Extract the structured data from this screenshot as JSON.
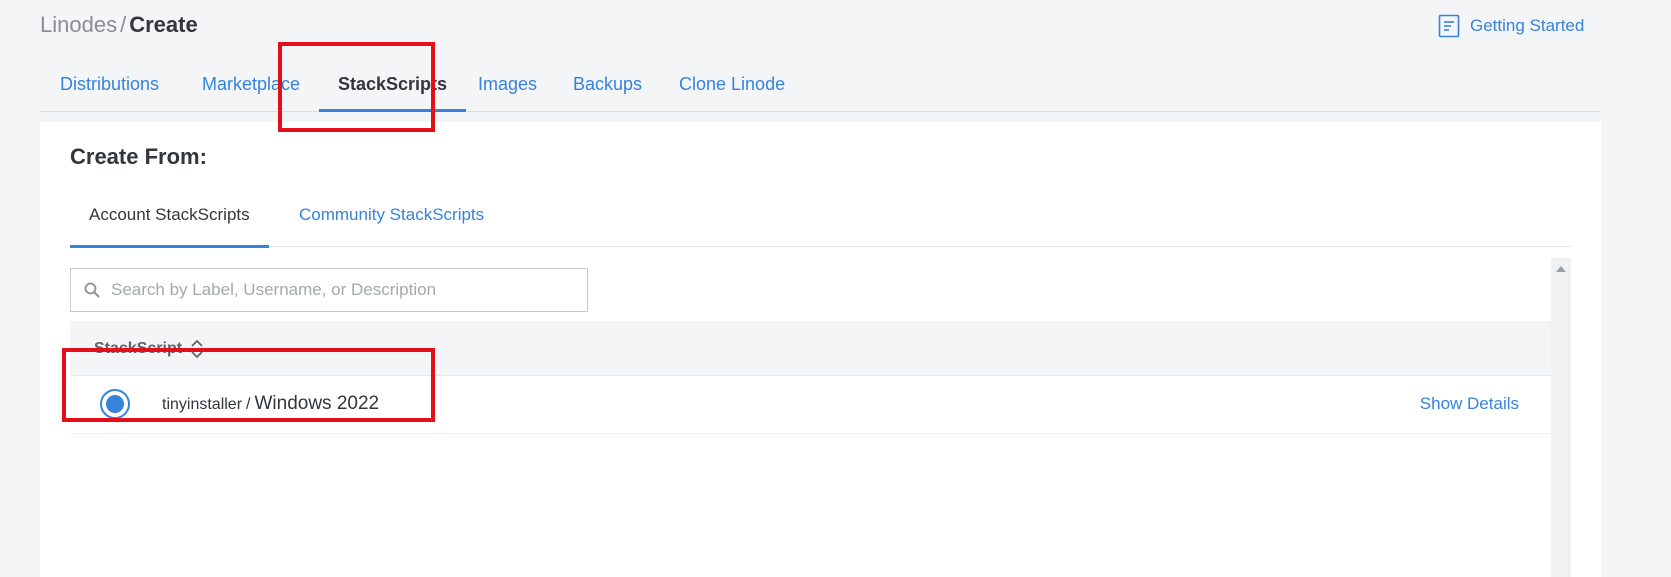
{
  "header": {
    "breadcrumb_parent": "Linodes",
    "breadcrumb_separator": "/",
    "breadcrumb_current": "Create",
    "getting_started": "Getting Started"
  },
  "tabs": [
    {
      "label": "Distributions",
      "active": false
    },
    {
      "label": "Marketplace",
      "active": false
    },
    {
      "label": "StackScripts",
      "active": true
    },
    {
      "label": "Images",
      "active": false
    },
    {
      "label": "Backups",
      "active": false
    },
    {
      "label": "Clone Linode",
      "active": false
    }
  ],
  "panel": {
    "title": "Create From:",
    "subtabs": [
      {
        "label": "Account StackScripts",
        "active": true
      },
      {
        "label": "Community StackScripts",
        "active": false
      }
    ],
    "search": {
      "placeholder": "Search by Label, Username, or Description",
      "value": ""
    },
    "table": {
      "column_header": "StackScript",
      "rows": [
        {
          "username": "tinyinstaller",
          "separator": "/",
          "title": "Windows 2022",
          "selected": true,
          "action": "Show Details"
        }
      ]
    }
  },
  "colors": {
    "accent": "#3683dc",
    "highlight": "#e3101a",
    "background": "#f4f5f6",
    "text": "#32363c"
  }
}
